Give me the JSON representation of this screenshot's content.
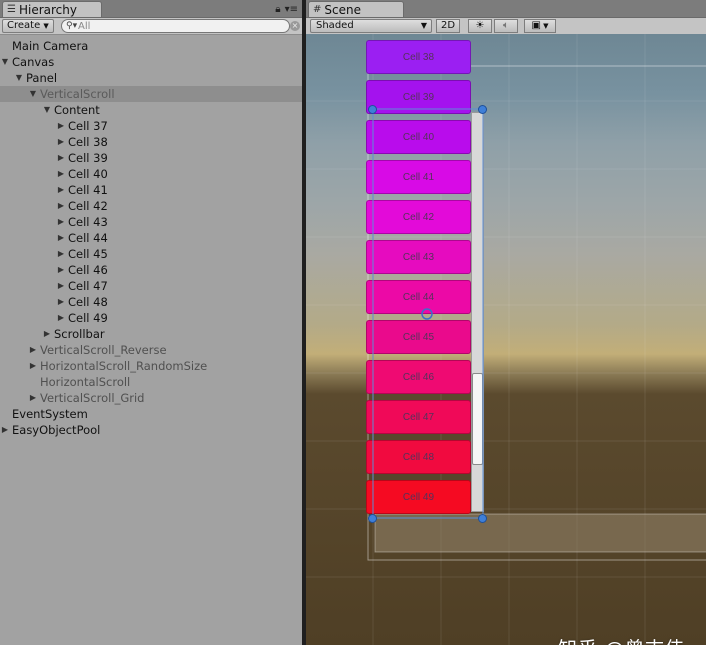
{
  "hierarchy": {
    "tab_title": "Hierarchy",
    "create_label": "Create",
    "search_placeholder": "All",
    "items": [
      {
        "label": "Main Camera",
        "depth": 0,
        "arrow": "none"
      },
      {
        "label": "Canvas",
        "depth": 0,
        "arrow": "expanded"
      },
      {
        "label": "Panel",
        "depth": 1,
        "arrow": "expanded"
      },
      {
        "label": "VerticalScroll",
        "depth": 2,
        "arrow": "expanded",
        "selected": true,
        "inactive": true
      },
      {
        "label": "Content",
        "depth": 3,
        "arrow": "expanded"
      },
      {
        "label": "Cell 37",
        "depth": 4,
        "arrow": "collapsed"
      },
      {
        "label": "Cell 38",
        "depth": 4,
        "arrow": "collapsed"
      },
      {
        "label": "Cell 39",
        "depth": 4,
        "arrow": "collapsed"
      },
      {
        "label": "Cell 40",
        "depth": 4,
        "arrow": "collapsed"
      },
      {
        "label": "Cell 41",
        "depth": 4,
        "arrow": "collapsed"
      },
      {
        "label": "Cell 42",
        "depth": 4,
        "arrow": "collapsed"
      },
      {
        "label": "Cell 43",
        "depth": 4,
        "arrow": "collapsed"
      },
      {
        "label": "Cell 44",
        "depth": 4,
        "arrow": "collapsed"
      },
      {
        "label": "Cell 45",
        "depth": 4,
        "arrow": "collapsed"
      },
      {
        "label": "Cell 46",
        "depth": 4,
        "arrow": "collapsed"
      },
      {
        "label": "Cell 47",
        "depth": 4,
        "arrow": "collapsed"
      },
      {
        "label": "Cell 48",
        "depth": 4,
        "arrow": "collapsed"
      },
      {
        "label": "Cell 49",
        "depth": 4,
        "arrow": "collapsed"
      },
      {
        "label": "Scrollbar",
        "depth": 3,
        "arrow": "collapsed"
      },
      {
        "label": "VerticalScroll_Reverse",
        "depth": 2,
        "arrow": "collapsed",
        "inactive": true
      },
      {
        "label": "HorizontalScroll_RandomSize",
        "depth": 2,
        "arrow": "collapsed",
        "inactive": true
      },
      {
        "label": "HorizontalScroll",
        "depth": 2,
        "arrow": "none",
        "inactive": true
      },
      {
        "label": "VerticalScroll_Grid",
        "depth": 2,
        "arrow": "collapsed",
        "inactive": true
      },
      {
        "label": "EventSystem",
        "depth": 0,
        "arrow": "none"
      },
      {
        "label": "EasyObjectPool",
        "depth": 0,
        "arrow": "collapsed"
      }
    ]
  },
  "scene": {
    "tab_title": "Scene",
    "shading_mode": "Shaded",
    "mode_2d_label": "2D",
    "cells": [
      {
        "label": "Cell 38",
        "color": "#9b1ff2"
      },
      {
        "label": "Cell 39",
        "color": "#a412ee"
      },
      {
        "label": "Cell 40",
        "color": "#b90cec"
      },
      {
        "label": "Cell 41",
        "color": "#d80ae6"
      },
      {
        "label": "Cell 42",
        "color": "#e30ad9"
      },
      {
        "label": "Cell 43",
        "color": "#e60bbf"
      },
      {
        "label": "Cell 44",
        "color": "#ec09a6"
      },
      {
        "label": "Cell 45",
        "color": "#ea0a8c"
      },
      {
        "label": "Cell 46",
        "color": "#ef0a72"
      },
      {
        "label": "Cell 47",
        "color": "#f00958"
      },
      {
        "label": "Cell 48",
        "color": "#f10a3f"
      },
      {
        "label": "Cell 49",
        "color": "#f50a22"
      }
    ],
    "scroll_position": 0.85,
    "watermark": "知乎 @曾志伟"
  }
}
